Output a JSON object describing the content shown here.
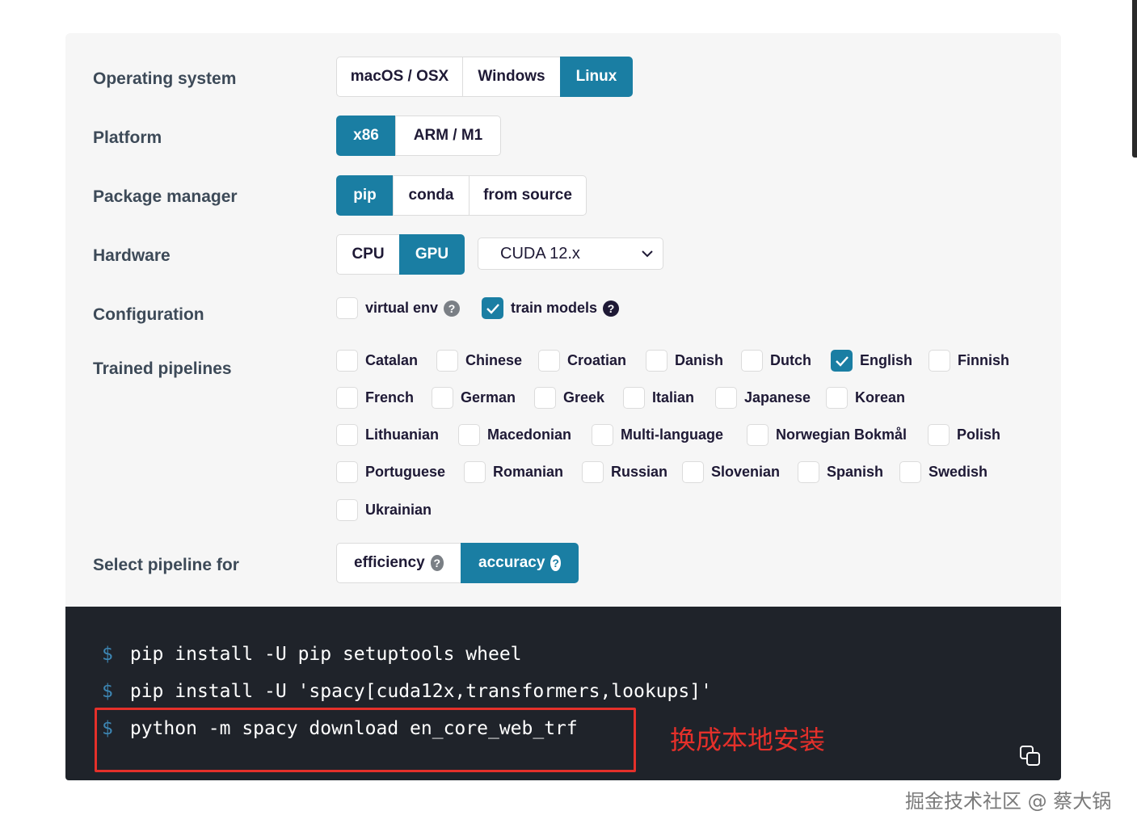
{
  "rows": {
    "os": {
      "label": "Operating system",
      "options": [
        "macOS / OSX",
        "Windows",
        "Linux"
      ],
      "selected": "Linux"
    },
    "platform": {
      "label": "Platform",
      "options": [
        "x86",
        "ARM / M1"
      ],
      "selected": "x86"
    },
    "package_manager": {
      "label": "Package manager",
      "options": [
        "pip",
        "conda",
        "from source"
      ],
      "selected": "pip"
    },
    "hardware": {
      "label": "Hardware",
      "options": [
        "CPU",
        "GPU"
      ],
      "selected": "GPU",
      "cuda_select": "CUDA 12.x"
    },
    "configuration": {
      "label": "Configuration",
      "items": [
        {
          "label": "virtual env",
          "checked": false
        },
        {
          "label": "train models",
          "checked": true
        }
      ]
    },
    "trained_pipelines": {
      "label": "Trained pipelines",
      "languages": [
        "Catalan",
        "Chinese",
        "Croatian",
        "Danish",
        "Dutch",
        "English",
        "Finnish",
        "French",
        "German",
        "Greek",
        "Italian",
        "Japanese",
        "Korean",
        "Lithuanian",
        "Macedonian",
        "Multi-language",
        "Norwegian Bokmål",
        "Polish",
        "Portuguese",
        "Romanian",
        "Russian",
        "Slovenian",
        "Spanish",
        "Swedish",
        "Ukrainian"
      ],
      "checked": [
        "English"
      ]
    },
    "select_pipeline": {
      "label": "Select pipeline for",
      "options": [
        "efficiency",
        "accuracy"
      ],
      "selected": "accuracy"
    }
  },
  "code": {
    "prompt": "$",
    "lines": [
      "pip install -U pip setuptools wheel",
      "pip install -U 'spacy[cuda12x,transformers,lookups]'",
      "python -m spacy download en_core_web_trf"
    ]
  },
  "annotation": {
    "text": "换成本地安装",
    "color": "#e5302a"
  },
  "watermark": "掘金技术社区 @ 蔡大锅",
  "colors": {
    "accent": "#1a7ea3",
    "panel": "#f6f6f6",
    "code_bg": "#1f232a",
    "prompt": "#3d86b3"
  }
}
